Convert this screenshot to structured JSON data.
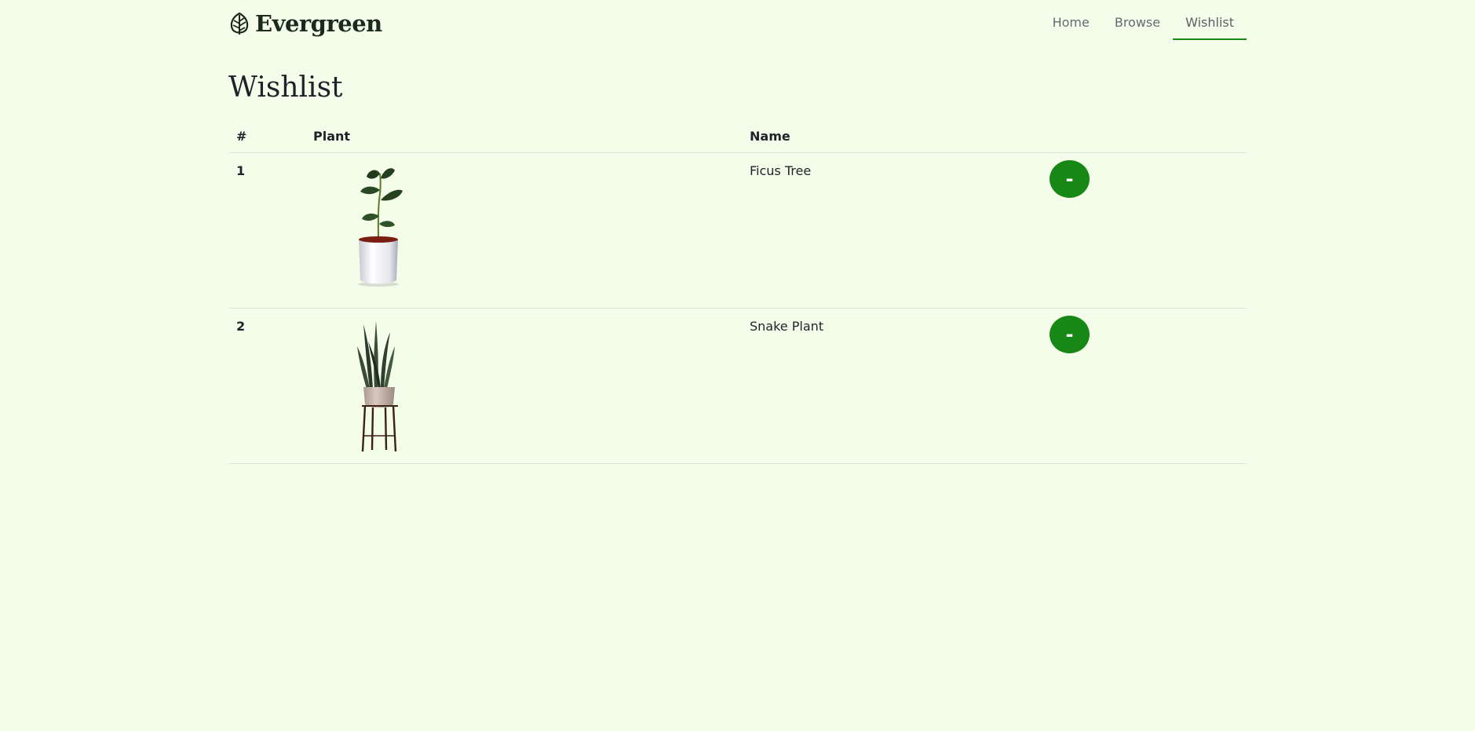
{
  "brand": {
    "name": "Evergreen",
    "icon": "leaf-logo-icon"
  },
  "nav": [
    {
      "label": "Home",
      "active": false
    },
    {
      "label": "Browse",
      "active": false
    },
    {
      "label": "Wishlist",
      "active": true
    }
  ],
  "page": {
    "title": "Wishlist"
  },
  "table": {
    "headers": [
      "#",
      "Plant",
      "Name",
      ""
    ],
    "rows": [
      {
        "num": "1",
        "plant_image": "ficus-tree-image",
        "name": "Ficus Tree",
        "action": "-"
      },
      {
        "num": "2",
        "plant_image": "snake-plant-image",
        "name": "Snake Plant",
        "action": "-"
      }
    ]
  },
  "colors": {
    "background": "#f3fdea",
    "accent": "#178815",
    "text": "#1f2329"
  }
}
